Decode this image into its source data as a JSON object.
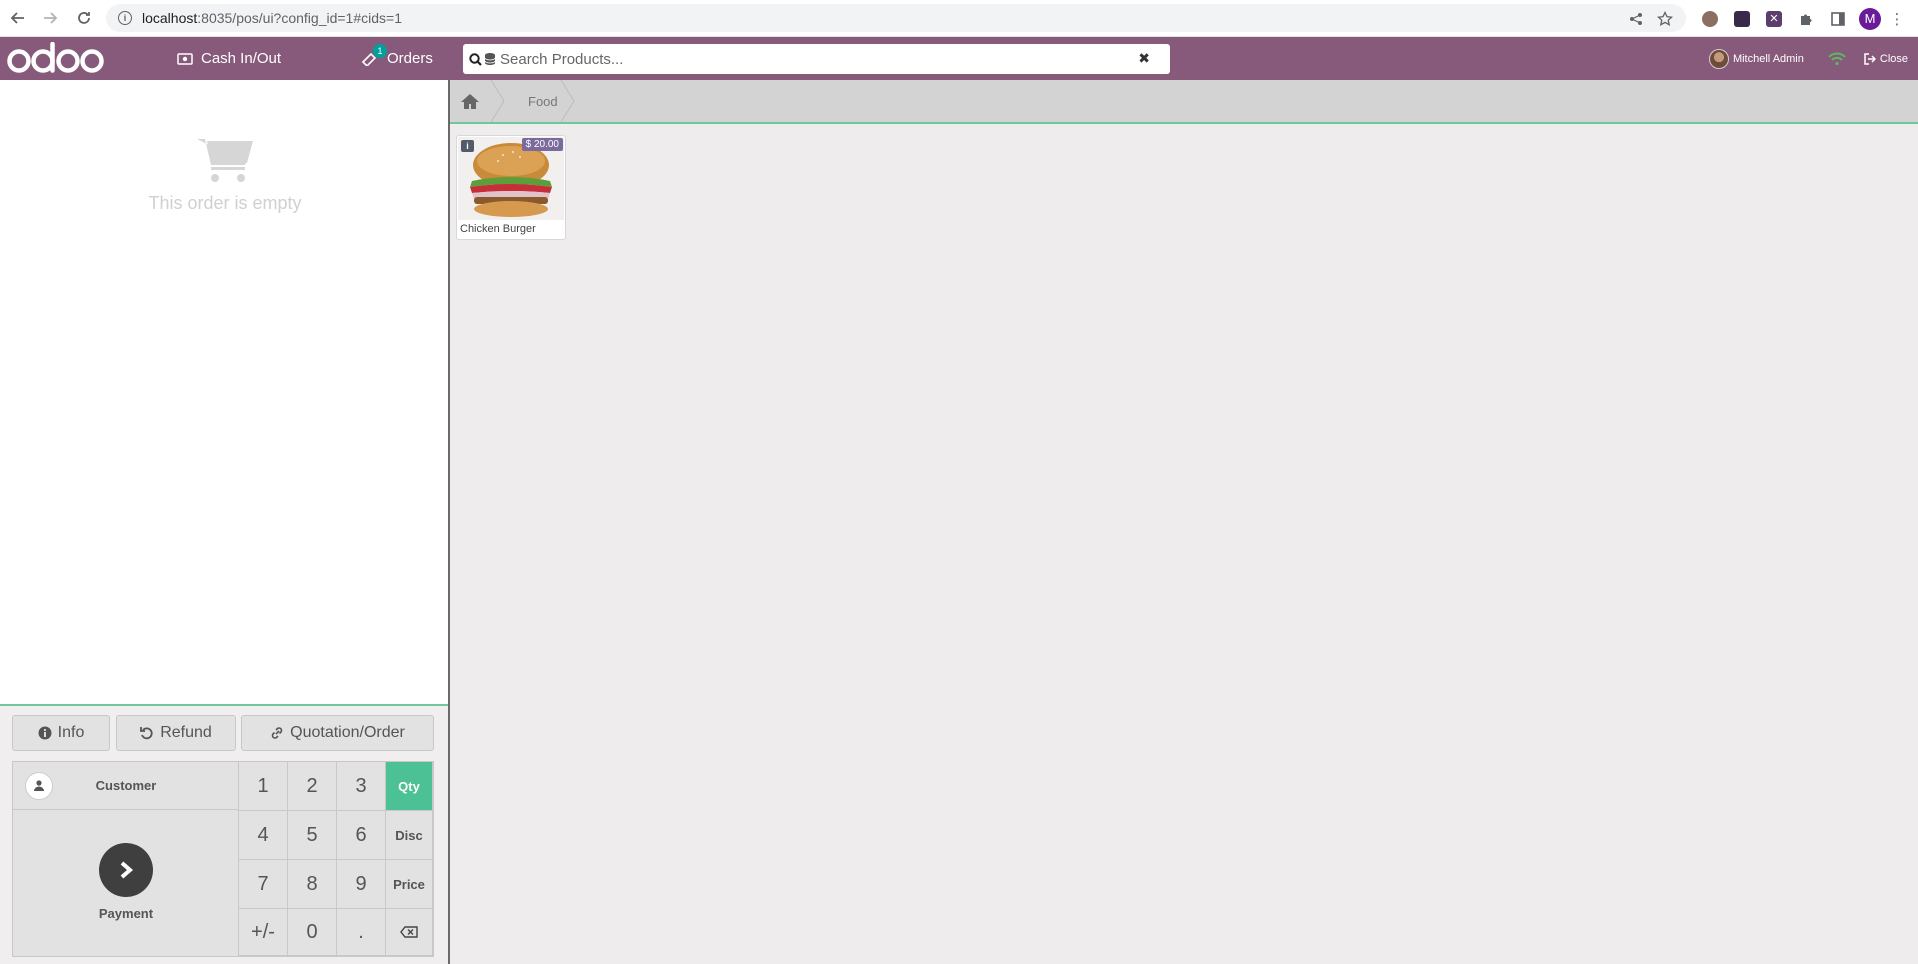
{
  "browser": {
    "url_host": "localhost",
    "url_rest": ":8035/pos/ui?config_id=1#cids=1",
    "profile_initial": "M"
  },
  "header": {
    "cash_label": "Cash In/Out",
    "orders_label": "Orders",
    "orders_badge": "1",
    "search_placeholder": "Search Products...",
    "user_name": "Mitchell Admin",
    "close_label": "Close",
    "brand_color": "#875a7b"
  },
  "order": {
    "empty_text": "This order is empty"
  },
  "controls": {
    "info_label": "Info",
    "refund_label": "Refund",
    "quotation_label": "Quotation/Order",
    "customer_label": "Customer",
    "payment_label": "Payment"
  },
  "numpad": {
    "keys": [
      "1",
      "2",
      "3",
      "4",
      "5",
      "6",
      "7",
      "8",
      "9",
      "+/-",
      "0",
      "."
    ],
    "qty": "Qty",
    "disc": "Disc",
    "price": "Price",
    "active_mode": "Qty",
    "accent_color": "#4bc195"
  },
  "categories": {
    "current": "Food"
  },
  "products": [
    {
      "name": "Chicken Burger",
      "price": "$ 20.00"
    }
  ]
}
